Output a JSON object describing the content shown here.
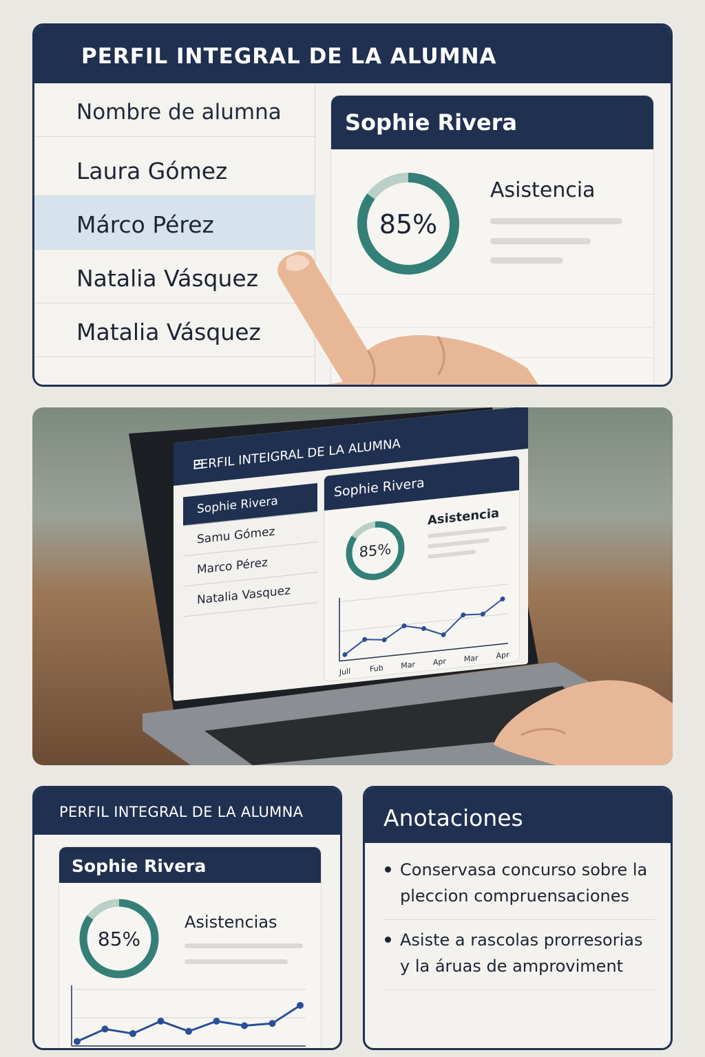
{
  "panel1": {
    "title": "PERFIL INTEGRAL DE LA ALUMNA",
    "list_header": "Nombre de alumna",
    "students": [
      "Laura Gómez",
      "Márco Pérez",
      "Natalia Vásquez",
      "Matalia Vásquez"
    ],
    "selected_index": 1,
    "detail": {
      "name": "Sophie Rivera",
      "percent_label": "85%",
      "percent_value": 85,
      "metric_label": "Asistencia"
    }
  },
  "panel2": {
    "title": "PERFIL INTEIGRAL DE LA ALUMNA",
    "menu_icon": "☰",
    "students": [
      "Sophie Rivera",
      "Samu Gómez",
      "Marco Pérez",
      "Natalia Vasquez"
    ],
    "selected_index": 0,
    "detail": {
      "name": "Sophie Rivera",
      "percent_label": "85%",
      "percent_value": 85,
      "metric_label": "Asistencia"
    },
    "chart_data": {
      "type": "line",
      "categories": [
        "Jull",
        "Fub",
        "Mar",
        "Apr",
        "Mar",
        "Apr"
      ],
      "values": [
        10,
        32,
        28,
        48,
        40,
        26,
        56,
        54,
        76
      ],
      "ylim": [
        0,
        100
      ],
      "grid": true
    }
  },
  "panel3": {
    "title": "PERFIL INTEGRAL DE LA ALUMNA",
    "detail": {
      "name": "Sophie Rivera",
      "percent_label": "85%",
      "percent_value": 85,
      "metric_label": "Asistencias"
    },
    "chart_data": {
      "type": "line",
      "values": [
        8,
        30,
        22,
        44,
        26,
        44,
        36,
        40,
        72
      ],
      "ylim": [
        0,
        100
      ],
      "grid": true
    }
  },
  "panel4": {
    "title": "Anotaciones",
    "notes": [
      "Conservasa concurso sobre la pleccion compruensaciones",
      "Asiste a rascolas prorresorias y la áruas de amproviment"
    ]
  },
  "colors": {
    "navy": "#1f3050",
    "teal": "#347f78",
    "teal_light": "#b9cfc7",
    "line_blue": "#2a4f96",
    "selected_row": "#d6e2ec"
  },
  "icons": [
    "pointing-hand-icon",
    "menu-icon",
    "typing-hand-icon"
  ]
}
